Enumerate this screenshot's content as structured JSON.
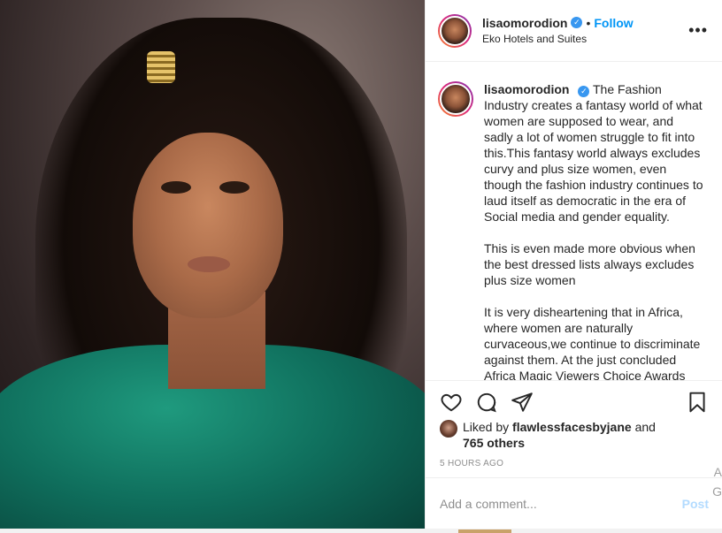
{
  "post": {
    "username": "lisaomorodion",
    "verified_icon": "verified-badge-icon",
    "dot": "•",
    "follow_label": "Follow",
    "location": "Eko Hotels and Suites",
    "more_icon": "more-options-icon",
    "more_glyph": "•••"
  },
  "caption": {
    "username": "lisaomorodion",
    "paragraphs": [
      "The Fashion Industry creates a fantasy world of what women are supposed to wear, and sadly a lot of women struggle to fit into this.This fantasy world always excludes curvy and plus size women, even though the fashion industry continues to laud itself as democratic in the era of Social media and gender equality.",
      "This is even made more obvious when the best dressed lists always excludes plus size women",
      "It is very disheartening that in Africa, where women are naturally curvaceous,we continue to discriminate against them. At the just concluded Africa Magic Viewers Choice Awards"
    ]
  },
  "actions": {
    "like_icon": "heart-icon",
    "comment_icon": "comment-bubble-icon",
    "share_icon": "share-paper-plane-icon",
    "save_icon": "bookmark-icon"
  },
  "likes": {
    "prefix": "Liked by",
    "liker": "flawlessfacesbyjane",
    "and": "and",
    "others": "765 others"
  },
  "timestamp": "5 HOURS AGO",
  "comment_box": {
    "placeholder": "Add a comment...",
    "post_label": "Post"
  },
  "edge_text": {
    "top": "A",
    "bottom": "G"
  },
  "colors": {
    "accent": "#0095f6",
    "verified": "#3897f0",
    "muted": "#8e8e8e",
    "post_disabled": "#b3dbff"
  }
}
